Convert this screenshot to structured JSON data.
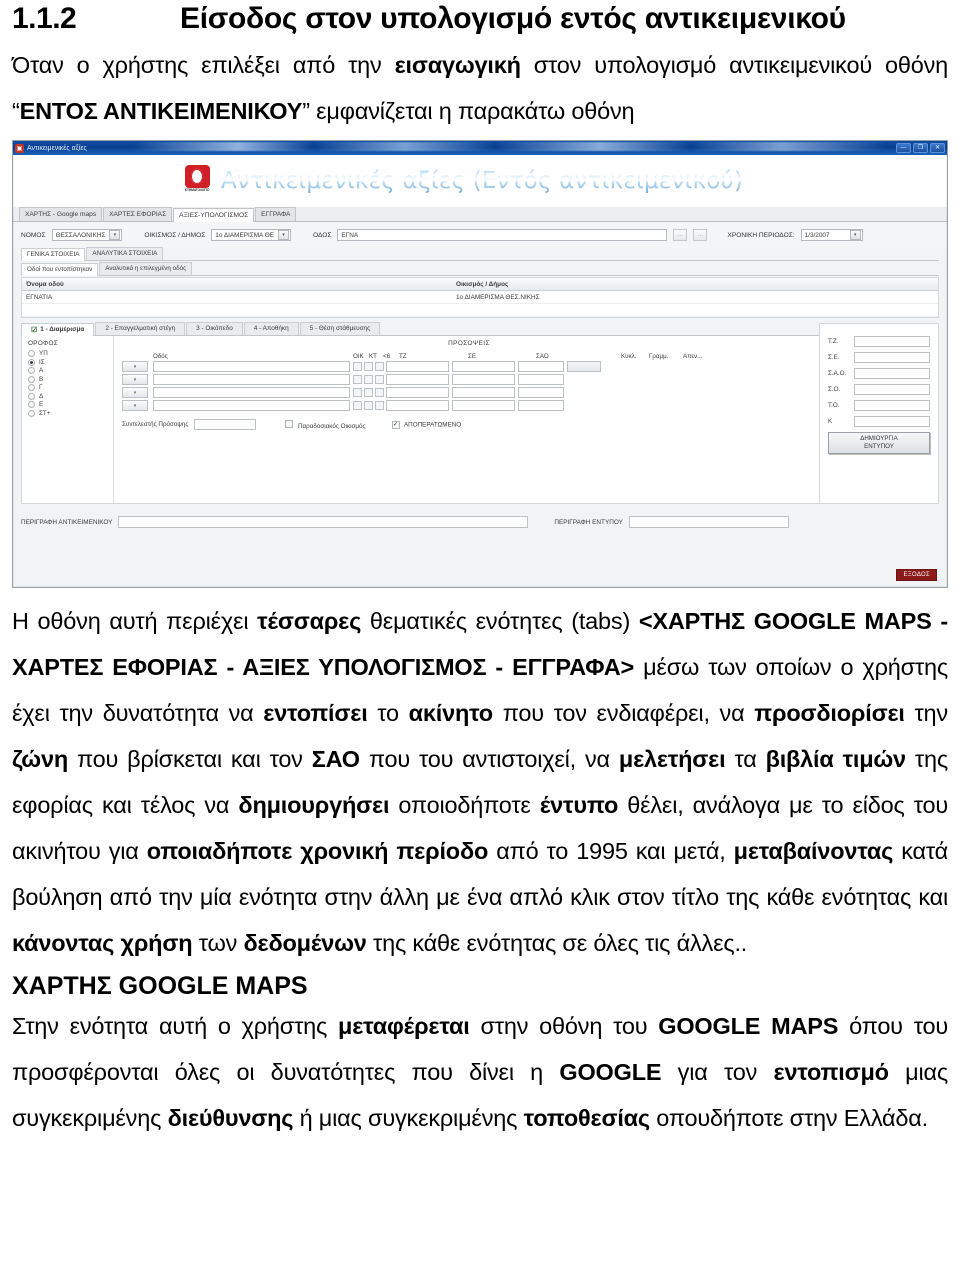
{
  "document": {
    "heading_number": "1.1.2",
    "heading_title": "Είσοδος στον υπολογισμό εντός αντικειμενικού",
    "intro_p1_a": "Όταν ο χρήστης επιλέξει από την ",
    "intro_p1_b": "εισαγωγική",
    "intro_p1_c": " στον υπολογισμό αντικειμενικού οθόνη “",
    "intro_p1_d": "ΕΝΤΟΣ ΑΝΤΙΚΕΙΜΕΝΙΚΟΥ",
    "intro_p1_e": "” εμφανίζεται η παρακάτω οθόνη",
    "p2_a": "Η οθόνη αυτή περιέχει ",
    "p2_b": "τέσσαρες",
    "p2_c": " θεματικές ενότητες (tabs) ",
    "p2_d": "<ΧΑΡΤΗΣ GOOGLE MAPS - ΧΑΡΤΕΣ ΕΦΟΡΙΑΣ - ΑΞΙΕΣ ΥΠΟΛΟΓΙΣΜΟΣ - ΕΓΓΡΑΦΑ>",
    "p2_e": " μέσω των οποίων ο χρήστης έχει την δυνατότητα να ",
    "p2_f": "εντοπίσει",
    "p2_g": " το ",
    "p2_h": "ακίνητο",
    "p2_i": " που τον ενδιαφέρει, να ",
    "p2_j": "προσδιορίσει",
    "p2_k": " την ",
    "p2_l": "ζώνη",
    "p2_m": " που βρίσκεται και τον ",
    "p2_n": "ΣΑΟ",
    "p2_o": " που του αντιστοιχεί, να ",
    "p2_p": "μελετήσει",
    "p2_q": " τα ",
    "p2_r": "βιβλία τιμών",
    "p2_s": " της εφορίας και τέλος να ",
    "p2_t": "δημιουργήσει",
    "p2_u": " οποιοδήποτε ",
    "p2_v": "έντυπο",
    "p2_w": " θέλει, ανάλογα με το είδος του ακινήτου για ",
    "p2_x": "οποιαδήποτε χρονική περίοδο",
    "p2_y": " από το 1995 και μετά, ",
    "p2_z": "μεταβαίνοντας",
    "p2_aa": " κατά βούληση από την μία ενότητα στην άλλη με ένα απλό κλικ στον τίτλο της κάθε ενότητας και ",
    "p2_ab": "κάνοντας χρήση",
    "p2_ac": " των ",
    "p2_ad": "δεδομένων",
    "p2_ae": " της κάθε ενότητας σε όλες τις άλλες..",
    "subheading": "ΧΑΡΤΗΣ GOOGLE MAPS",
    "p3_a": "Στην ενότητα αυτή ο χρήστης ",
    "p3_b": "μεταφέρεται",
    "p3_c": " στην οθόνη του ",
    "p3_d": "GOOGLE MAPS",
    "p3_e": " όπου του προσφέρονται όλες οι δυνατότητες που δίνει η ",
    "p3_f": "GOOGLE",
    "p3_g": " για τον ",
    "p3_h": "εντοπισμό",
    "p3_i": " μιας συγκεκριμένης ",
    "p3_j": "διεύθυνσης",
    "p3_k": " ή μιας συγκεκριμένης ",
    "p3_l": "τοποθεσίας",
    "p3_m": " οπουδήποτε στην Ελλάδα."
  },
  "app": {
    "window_title": "Αντικειμενικές αξίες",
    "window_buttons": {
      "minimize": "—",
      "maximize": "❐",
      "close": "✕"
    },
    "banner_title": "Αντικειμενικές αξίες (Εντός αντικειμενικού)",
    "logo_caption": "ΚΤΗΜΑΤΟΛΟΓΙΟ",
    "tabs": [
      {
        "label": "ΧΑΡΤΗΣ - Google maps",
        "active": false
      },
      {
        "label": "ΧΑΡΤΕΣ ΕΦΟΡΙΑΣ",
        "active": false
      },
      {
        "label": "ΑΞΙΕΣ-ΥΠΟΛΟΓΙΣΜΟΣ",
        "active": true
      },
      {
        "label": "ΕΓΓΡΑΦΑ",
        "active": false
      }
    ],
    "toolbar": {
      "nomos_label": "ΝΟΜΟΣ",
      "nomos_value": "ΘΕΣΣΑΛΟΝΙΚΗΣ",
      "oikismos_label": "ΟΙΚΙΣΜΟΣ / ΔΗΜΟΣ",
      "oikismos_value": "1ο ΔΙΑΜΕΡΙΣΜΑ ΘΕ",
      "odos_label": "ΟΔΟΣ",
      "odos_value": "ΕΓΝΑ",
      "btn1": "…",
      "btn2": "…",
      "period_label": "ΧΡΟΝΙΚΗ ΠΕΡΙΟΔΟΣ:",
      "period_value": "1/3/2007"
    },
    "subtabs_level1": [
      {
        "label": "ΓΕΝΙΚΑ ΣΤΟΙΧΕΙΑ",
        "active": true
      },
      {
        "label": "ΑΝΑΛΥΤΙΚΑ ΣΤΟΙΧΕΙΑ",
        "active": false
      }
    ],
    "subtabs_level2": [
      {
        "label": "Οδοί που εντοπίστηκαν",
        "active": true
      },
      {
        "label": "Αναλυτικά η επιλεγμένη οδός",
        "active": false
      }
    ],
    "streets_grid": {
      "headers": [
        "Όνομα οδού",
        "Οικισμός / Δήμος"
      ],
      "rows": [
        [
          "ΕΓΝΑΤΙΑ",
          "1ο ΔΙΑΜΕΡΙΣΜΑ ΘΕΣ.ΝΙΚΗΣ"
        ]
      ]
    },
    "numbered_tabs": [
      {
        "label": "1 - Διαμέρισμα",
        "active": true,
        "icon": "check-icon"
      },
      {
        "label": "2 - Επαγγελματική στέγη",
        "active": false
      },
      {
        "label": "3 - Οικόπεδο",
        "active": false
      },
      {
        "label": "4 - Αποθήκη",
        "active": false
      },
      {
        "label": "5 - Θέση στάθμευσης",
        "active": false
      }
    ],
    "floors": {
      "caption": "ΟΡΟΦΟΣ",
      "options": [
        {
          "label": "ΥΠ",
          "selected": false
        },
        {
          "label": "ΙΣ",
          "selected": true
        },
        {
          "label": "Α",
          "selected": false
        },
        {
          "label": "Β",
          "selected": false
        },
        {
          "label": "Γ",
          "selected": false
        },
        {
          "label": "Δ",
          "selected": false
        },
        {
          "label": "Ε",
          "selected": false
        },
        {
          "label": "ΣΤ+",
          "selected": false
        }
      ]
    },
    "facades": {
      "caption": "ΠΡΟΣΟΨΕΙΣ",
      "headers": [
        "Οδός",
        "ΟΙΚ",
        "ΚΤ",
        "<6",
        "ΤΖ",
        "ΣΕ",
        "ΣΑΟ",
        "Κυκλ.",
        "Γραμμ.",
        "Απεν..."
      ],
      "coef_label": "Συντελεστής Πρόσοψης",
      "coef_value": "",
      "traditional_label": "Παραδοσιακός Οικισμός",
      "traditional_checked": false,
      "completed_label": "ΑΠΟΠΕΡΑΤΩΜΕΝΟ",
      "completed_checked": true
    },
    "side_panel": {
      "fields": [
        {
          "label": "Τ.Ζ.",
          "value": ""
        },
        {
          "label": "Σ.Ε.",
          "value": ""
        },
        {
          "label": "Σ.Α.Ο.",
          "value": ""
        },
        {
          "label": "Σ.Ο.",
          "value": ""
        },
        {
          "label": "Τ.Ο.",
          "value": ""
        },
        {
          "label": "Κ",
          "value": ""
        }
      ],
      "button_line1": "ΔΗΜΙΟΥΡΓΙΑ",
      "button_line2": "ΕΝΤΥΠΟΥ"
    },
    "footer": {
      "desc_obj_label": "ΠΕΡΙΓΡΑΦΗ ΑΝΤΙΚΕΙΜΕΝΙΚΟΥ",
      "desc_obj_value": "",
      "desc_form_label": "ΠΕΡΙΓΡΑΦΗ ΕΝΤΥΠΟΥ",
      "desc_form_value": "",
      "exit_button": "ΕΞΟΔΟΣ"
    },
    "colors": {
      "titlebar": "#0b4798",
      "exit_button": "#8b1a1a",
      "logo": "#d01f26",
      "banner_text": "#8fc4e8"
    }
  }
}
